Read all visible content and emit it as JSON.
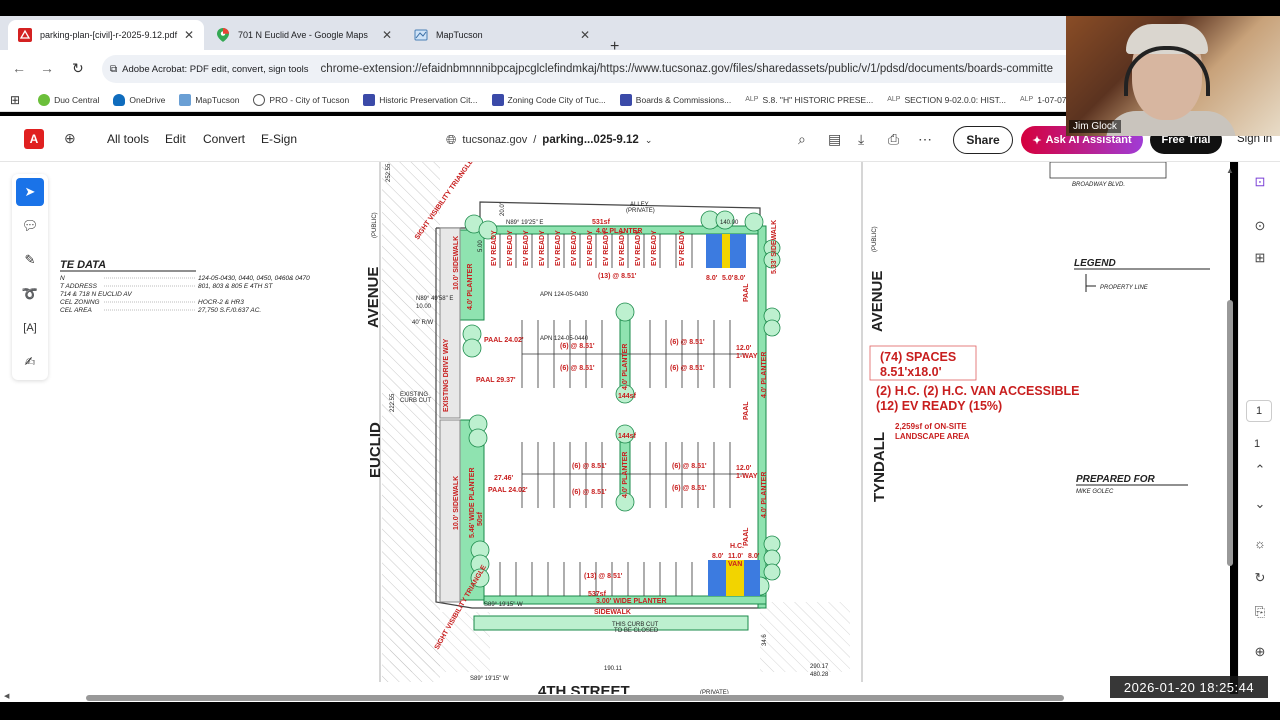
{
  "tabs": [
    {
      "label": "parking-plan-[civil]-r-2025-9.12.pdf",
      "active": true
    },
    {
      "label": "701 N Euclid Ave - Google Maps",
      "active": false
    },
    {
      "label": "MapTucson",
      "active": false
    }
  ],
  "omnibox": {
    "extension_label": "Adobe Acrobat: PDF edit, convert, sign tools",
    "url": "chrome-extension://efaidnbmnnnibpcajpcglclefindmkaj/https://www.tucsonaz.gov/files/sharedassets/public/v/1/pdsd/documents/boards-committe"
  },
  "bookmarks": [
    "Duo Central",
    "OneDrive",
    "MapTucson",
    "PRO - City of Tucson",
    "Historic Preservation Cit...",
    "Zoning Code City of Tuc...",
    "Boards & Commissions...",
    "S.8. \"H\" HISTORIC PRESE...",
    "SECTION 9-02.0.0: HIST...",
    "1-07-07"
  ],
  "bookmark_prefix": {
    "alp1": "ALP",
    "alp2": "ALP",
    "alp3": "ALP"
  },
  "acrobat": {
    "menu": [
      "All tools",
      "Edit",
      "Convert",
      "E-Sign"
    ],
    "domain": "tucsonaz.gov",
    "separator": "/",
    "doc_name": "parking...025-9.12",
    "share": "Share",
    "ai_assistant": "Ask AI Assistant",
    "free_trial": "Free Trial",
    "sign_in": "Sign in"
  },
  "video": {
    "participant_name": "Jim Glock"
  },
  "page_indicator": {
    "current": "1",
    "total": "1"
  },
  "timestamp": "2026-01-20  18:25:44",
  "plan": {
    "site_data_title": "TE DATA",
    "site_data_lines": [
      {
        "k": "N",
        "v": "124-05-0430, 0440, 0450, 0460& 0470"
      },
      {
        "k": "T ADDRESS",
        "v": "801, 803 & 805 E 4TH ST"
      },
      {
        "k": "714 & 718 N EUCLID AV",
        "v": ""
      },
      {
        "k": "CEL ZONING",
        "v": "HOCR-2 & HR3"
      },
      {
        "k": "CEL AREA",
        "v": "27,750 S.F./0.637 AC."
      }
    ],
    "street_left_top": "AVENUE",
    "street_left_bottom": "EUCLID",
    "street_right_top": "AVENUE",
    "street_right_bottom": "TYNDALL",
    "street_bottom": "4TH    STREET",
    "public_left": "(PUBLIC)",
    "public_right": "(PUBLIC)",
    "private_bottom": "(PRIVATE)",
    "alley": "ALLEY",
    "alley_sub": "(PRIVATE)",
    "broadway": "BROADWAY  BLVD.",
    "legend_title": "LEGEND",
    "legend_item": "PROPERTY LINE",
    "prepared_for": "PREPARED FOR",
    "prepared_name": "MIKE GOLEC",
    "summary_spaces": "(74) SPACES",
    "summary_size": "8.51'x18.0'",
    "summary_hc": "(2) H.C. (2) H.C. VAN ACCESSIBLE",
    "summary_ev": "(12) EV READY (15%)",
    "summary_landscape_1": "2,259sf of ON-SITE",
    "summary_landscape_2": "LANDSCAPE AREA",
    "ev_ready": "EV READY",
    "planter_top": "4.0' PLANTER",
    "planter_bottom": "3.00' WIDE PLANTER",
    "sidewalk_bottom": "SIDEWALK",
    "curb_cut_1": "THIS CURB CUT",
    "curb_cut_2": "TO BE CLOSED",
    "apn_top": "APN 124-05-0430",
    "apn_mid": "APN 124-05-0440",
    "row_count_top": "(13) @ 8.51'",
    "row_count_bottom": "(13) @ 8.51'",
    "six_at": "(6) @ 8.51'",
    "one_way": "1-WAY",
    "paal": "PAAL",
    "paal_1": "PAAL 24.02'",
    "paal_2": "PAAL 29.37'",
    "paal_3": "PAAL 24.02'",
    "dim_12": "12.0'",
    "dim_2746": "27.46'",
    "sf_144a": "144sf",
    "sf_144b": "144sf",
    "sf_531": "531sf",
    "sf_537": "537sf",
    "hc": "H.C.",
    "van": "VAN",
    "dim_80": "8.0'",
    "dim_50": "5.0'",
    "dim_110": "11.0'",
    "dim_8": "8.0'",
    "dim_14000": "140.00",
    "dim_19011": "190.11",
    "dim_29017": "290.17",
    "dim_48028": "480.28",
    "dim_22255": "222.55",
    "dim_25255": "252.55",
    "dim_346": "34.6",
    "bearing_top": "N89° 19'25\" E",
    "bearing_bottom": "S89° 19'15\" W",
    "bearing_bottom2": "S89° 19'15\" W",
    "bearing_left": "N89° 49'58\" E",
    "dim_1000": "10.00",
    "row_40": "40' R/W",
    "sight_vis": "SIGHT VISIBILITY TRIANGLE",
    "sidewalk_left": "10.0' SIDEWALK",
    "sidewalk_left2": "10.0' SIDEWALK",
    "wide_planter": "5.46' WIDE PLANTER",
    "existing_curb": "EXISTING",
    "existing_curb2": "CURB CUT",
    "existing_drive": "EXISTING DRIVE WAY",
    "sf_50": "50sf",
    "planter_v": "4.0' PLANTER",
    "sidewalk_right": "5.33' SIDEWALK",
    "dim_20": "20.0'",
    "dim_500": "5.00"
  }
}
